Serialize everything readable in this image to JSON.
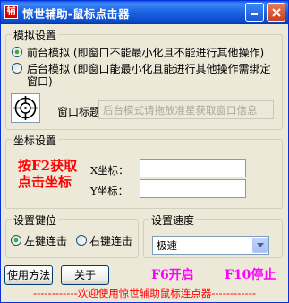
{
  "window": {
    "title": "惊世辅助-鼠标点击器",
    "app_icon_glyph": "辅",
    "min_icon": "minimize-icon",
    "close_icon": "close-icon"
  },
  "simulation": {
    "group_label": "模拟设置",
    "foreground_label": "前台模拟 (即窗口不能最小化且不能进行其他操作)",
    "background_label_line1": "后台模拟 (即窗口能最小化且能进行其他操作需绑定",
    "background_label_line2": "窗口)",
    "selected": "foreground",
    "window_title_label": "窗口标题：",
    "window_title_placeholder": "后台模式请拖放准星获取窗口信息",
    "crosshair_icon": "crosshair-icon"
  },
  "coordinates": {
    "group_label": "坐标设置",
    "hint_line1": "按F2获取",
    "hint_line2": "点击坐标",
    "x_label": "X坐标：",
    "y_label": "Y坐标：",
    "x_value": "",
    "y_value": ""
  },
  "keys": {
    "group_label": "设置键位",
    "left_label": "左键连击",
    "right_label": "右键连击",
    "selected": "left"
  },
  "speed": {
    "group_label": "设置速度",
    "value": "极速"
  },
  "buttons": {
    "usage": "使用方法",
    "about": "关于"
  },
  "hotkeys": {
    "start": "F6开启",
    "stop": "F10停止"
  },
  "footer": "------------欢迎使用惊世辅助鼠标连点器------------",
  "colors": {
    "title_bar": "#0a5ae8",
    "hint_red": "#ff0000",
    "hotkey_magenta": "#ff00ff",
    "radio_checked": "#2fb32f"
  }
}
